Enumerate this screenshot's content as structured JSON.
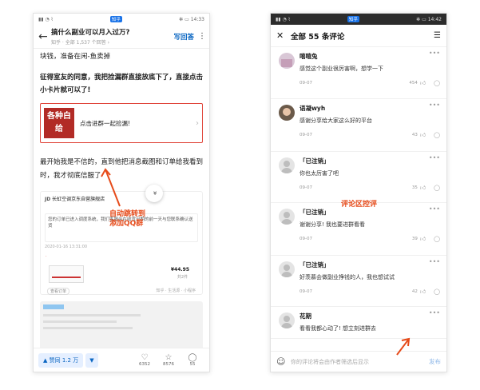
{
  "left": {
    "status": {
      "time": "14:33",
      "app_badge": "知乎"
    },
    "header": {
      "title": "搞什么副业可以月入过万?",
      "subtitle": "知乎 · 全部 1,537 个回答 ›",
      "write_answer": "写回答",
      "more": "⋮"
    },
    "article": {
      "p1": "块钱，准备在闲-鱼卖掉",
      "p2": "征得室友的同意，我把捡漏群直接放底下了，直接点击小卡片就可以了!",
      "card": {
        "logo": "各种白给",
        "text": "点击进群一起捡漏!",
        "arrow": "›"
      },
      "p3": "最开始我是不信的，直到他把消息截图和订单给我看到时，我才彻底信服了",
      "embed": {
        "header_jd": "JD",
        "header": "长虹空调京东自营旗舰店",
        "message": "您的订单已进入调度系统，我们客服会在收货日期的前一天与您联系确认送货",
        "date": "2020-01-16 13:31:00",
        "dot": "·",
        "price": "¥44.95",
        "qty": "共2件",
        "button": "查看订单",
        "source": "知乎 · 生活源 · 小程序"
      }
    },
    "fab_icon": "double-chevron-down",
    "fab": "»",
    "bottom": {
      "vote_up": "▲ 赞同 1.2 万",
      "vote_down": "▼",
      "like": "6352",
      "like_icon": "♡",
      "fav": "8576",
      "fav_icon": "☆",
      "comment": "55",
      "comment_icon": "◯"
    }
  },
  "annotations": {
    "left": "自动跳转到\n添加QQ群",
    "right": "评论区控评",
    "color": "#e64a19"
  },
  "right": {
    "status": {
      "time": "14:42",
      "app_badge": "知乎"
    },
    "header": {
      "close": "✕",
      "title": "全部 55 条评论",
      "sort": "☰"
    },
    "comments": [
      {
        "name": "嘻嘻兔",
        "text": "感觉这个副业很厉害啊，想学一下",
        "date": "09-07",
        "likes": "454",
        "avatar": "img"
      },
      {
        "name": "语凝wyh",
        "text": "感谢分享给大家这么好的平台",
        "date": "09-07",
        "likes": "43",
        "avatar": "photo"
      },
      {
        "name": "「已注销」",
        "text": "你也太厉害了吧",
        "date": "09-07",
        "likes": "35",
        "avatar": "def"
      },
      {
        "name": "「已注销」",
        "text": "谢谢分享! 我也要进群看看",
        "date": "09-07",
        "likes": "39",
        "avatar": "def"
      },
      {
        "name": "「已注销」",
        "text": "好羡慕会做副业挣钱的人，我也想试试",
        "date": "09-07",
        "likes": "42",
        "avatar": "def"
      },
      {
        "name": "花期",
        "text": "看看我都心动了! 想立刻进群去",
        "date": "09-07",
        "likes": "",
        "avatar": "def"
      }
    ],
    "bottom": {
      "emoji_icon": "☺",
      "placeholder": "你的评论将会由作者筛选后显示",
      "publish": "发布"
    }
  }
}
